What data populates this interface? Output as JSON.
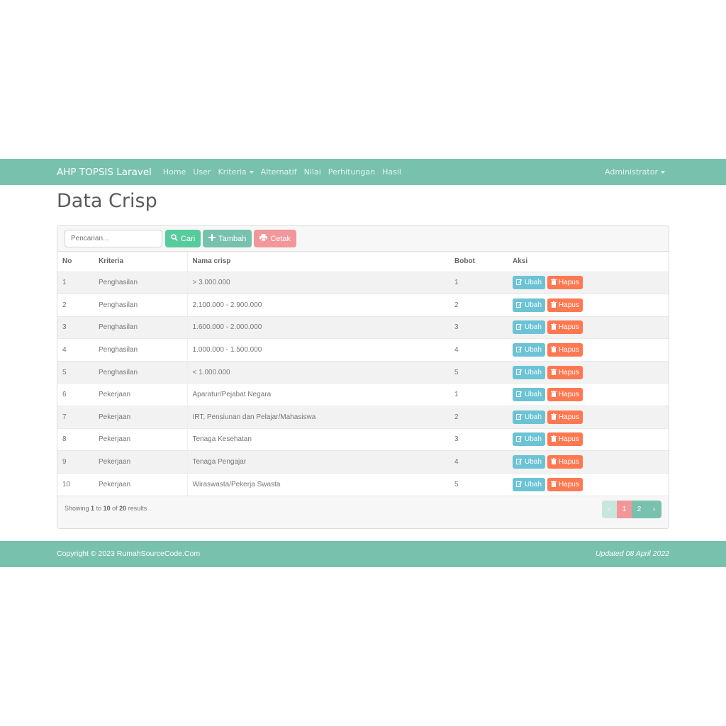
{
  "navbar": {
    "brand": "AHP TOPSIS Laravel",
    "links": [
      "Home",
      "User",
      "Kriteria",
      "Alternatif",
      "Nilai",
      "Perhitungan",
      "Hasil"
    ],
    "user_menu": "Administrator"
  },
  "page": {
    "title": "Data Crisp"
  },
  "toolbar": {
    "search_placeholder": "Pencarian...",
    "search_label": "Cari",
    "add_label": "Tambah",
    "print_label": "Cetak"
  },
  "table": {
    "headers": [
      "No",
      "Kriteria",
      "Nama crisp",
      "Bobot",
      "Aksi"
    ],
    "rows": [
      {
        "no": "1",
        "kriteria": "Penghasilan",
        "nama": "> 3.000.000",
        "bobot": "1"
      },
      {
        "no": "2",
        "kriteria": "Penghasilan",
        "nama": "2.100.000 - 2.900.000",
        "bobot": "2"
      },
      {
        "no": "3",
        "kriteria": "Penghasilan",
        "nama": "1.600.000 - 2.000.000",
        "bobot": "3"
      },
      {
        "no": "4",
        "kriteria": "Penghasilan",
        "nama": "1.000.000 - 1.500.000",
        "bobot": "4"
      },
      {
        "no": "5",
        "kriteria": "Penghasilan",
        "nama": "< 1.000.000",
        "bobot": "5"
      },
      {
        "no": "6",
        "kriteria": "Pekerjaan",
        "nama": "Aparatur/Pejabat Negara",
        "bobot": "1"
      },
      {
        "no": "7",
        "kriteria": "Pekerjaan",
        "nama": "IRT, Pensiunan dan Pelajar/Mahasiswa",
        "bobot": "2"
      },
      {
        "no": "8",
        "kriteria": "Pekerjaan",
        "nama": "Tenaga Kesehatan",
        "bobot": "3"
      },
      {
        "no": "9",
        "kriteria": "Pekerjaan",
        "nama": "Tenaga Pengajar",
        "bobot": "4"
      },
      {
        "no": "10",
        "kriteria": "Pekerjaan",
        "nama": "Wiraswasta/Pekerja Swasta",
        "bobot": "5"
      }
    ],
    "edit_label": "Ubah",
    "delete_label": "Hapus"
  },
  "pagination": {
    "showing": {
      "prefix": "Showing",
      "from": "1",
      "to_word": "to",
      "to": "10",
      "of_word": "of",
      "total": "20",
      "suffix": "results"
    },
    "prev": "‹",
    "pages": [
      "1",
      "2"
    ],
    "next": "›"
  },
  "footer": {
    "copyright": "Copyright © 2023 RumahSourceCode.Com",
    "updated": "Updated 08 April 2022"
  },
  "colors": {
    "primary": "#78c2ad",
    "success": "#56cc9d",
    "secondary": "#f3969a",
    "info": "#6cc3d5",
    "danger": "#ff7851"
  }
}
